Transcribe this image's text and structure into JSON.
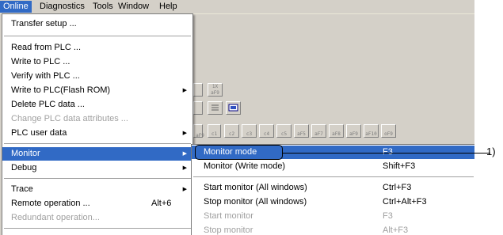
{
  "menubar": {
    "items": [
      "Online",
      "Diagnostics",
      "Tools",
      "Window",
      "Help"
    ]
  },
  "toolbar": {
    "row1": [
      "1X",
      "aF9"
    ],
    "row3": [
      "aF9",
      "c1",
      "c2",
      "c3",
      "c4",
      "c5",
      "aF5",
      "aF7",
      "aF8",
      "aF9",
      "aF10",
      "oF9"
    ]
  },
  "online_menu": {
    "items": [
      {
        "label": "Transfer setup ..."
      },
      {
        "label": "Read from PLC ..."
      },
      {
        "label": "Write to PLC ..."
      },
      {
        "label": "Verify with PLC ..."
      },
      {
        "label": "Write to PLC(Flash ROM)"
      },
      {
        "label": "Delete PLC data ..."
      },
      {
        "label": "Change PLC data attributes ..."
      },
      {
        "label": "PLC user data"
      },
      {
        "label": "Monitor"
      },
      {
        "label": "Debug"
      },
      {
        "label": "Trace"
      },
      {
        "label": "Remote operation ...",
        "shortcut": "Alt+6"
      },
      {
        "label": "Redundant operation..."
      }
    ]
  },
  "monitor_submenu": {
    "items": [
      {
        "label": "Monitor mode",
        "shortcut": "F3"
      },
      {
        "label": "Monitor (Write mode)",
        "shortcut": "Shift+F3"
      },
      {
        "label": "Start monitor (All windows)",
        "shortcut": "Ctrl+F3"
      },
      {
        "label": "Stop monitor (All windows)",
        "shortcut": "Ctrl+Alt+F3"
      },
      {
        "label": "Start monitor",
        "shortcut": "F3"
      },
      {
        "label": "Stop monitor",
        "shortcut": "Alt+F3"
      }
    ]
  },
  "callout": {
    "label": "1)"
  },
  "colors": {
    "highlight": "#316ac5",
    "menu_bg": "#ffffff",
    "app_bg": "#d4d0c8",
    "disabled_text": "#a0a0a0"
  }
}
